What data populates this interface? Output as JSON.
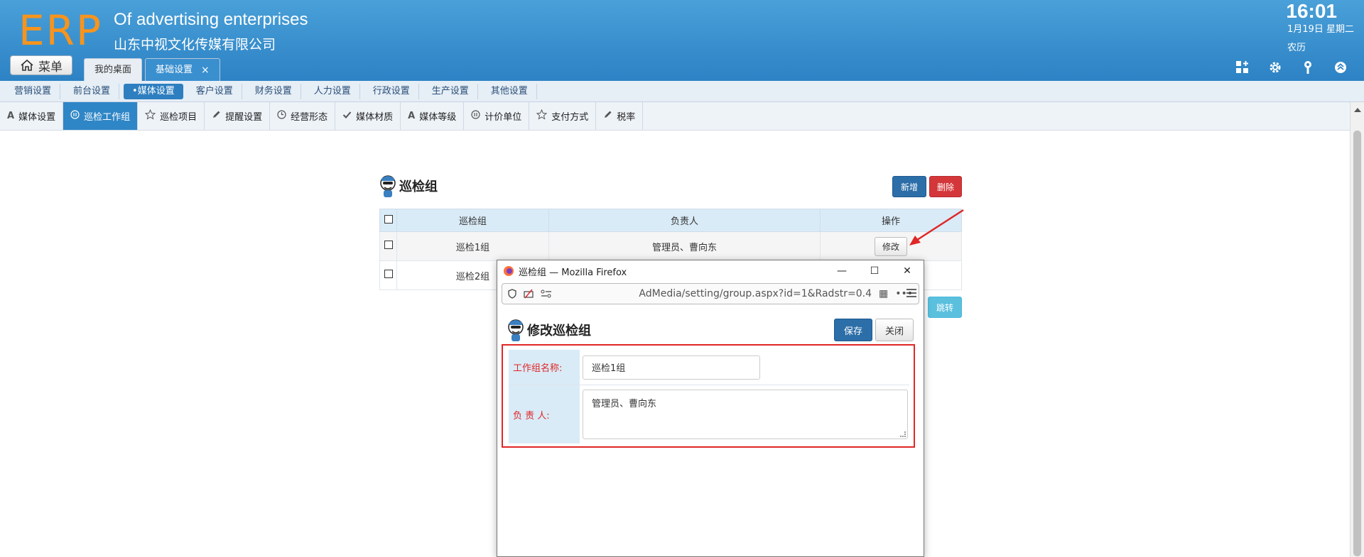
{
  "header": {
    "logo": "ERP",
    "company_en": "Of advertising enterprises",
    "company_cn": "山东中视文化传媒有限公司",
    "time": "16:01",
    "date": "1月19日 星期二",
    "lunar": "农历",
    "menu_label": "菜单"
  },
  "tabs": [
    {
      "label": "我的桌面"
    },
    {
      "label": "基础设置",
      "close": "×"
    }
  ],
  "nav1": [
    "营销设置",
    "前台设置",
    "•媒体设置",
    "客户设置",
    "财务设置",
    "人力设置",
    "行政设置",
    "生产设置",
    "其他设置"
  ],
  "nav2": [
    "媒体设置",
    "巡检工作组",
    "巡检项目",
    "提醒设置",
    "经营形态",
    "媒体材质",
    "媒体等级",
    "计价单位",
    "支付方式",
    "税率"
  ],
  "section": {
    "title": "巡检组",
    "new_label": "新增",
    "delete_label": "删除",
    "jump_label": "跳转"
  },
  "table": {
    "headers": [
      "巡检组",
      "负责人",
      "操作"
    ],
    "rows": [
      {
        "name": "巡检1组",
        "owner": "管理员、曹向东",
        "action": "修改"
      },
      {
        "name": "巡检2组",
        "owner": "",
        "action": ""
      }
    ]
  },
  "popup": {
    "window_title": "巡检组 — Mozilla Firefox",
    "url": "AdMedia/setting/group.aspx?id=1&Radstr=0.4",
    "heading": "修改巡检组",
    "save_label": "保存",
    "close_label": "关闭",
    "fields": {
      "name_label": "工作组名称:",
      "name_value": "巡检1组",
      "owner_label": "负 责 人:",
      "owner_value": "管理员、曹向东"
    }
  },
  "colors": {
    "header_bg": "#2c82c4",
    "logo": "#f7941d",
    "primary_button": "#2c6ea8",
    "danger_button": "#d4373a",
    "highlight_frame": "#e02626"
  }
}
